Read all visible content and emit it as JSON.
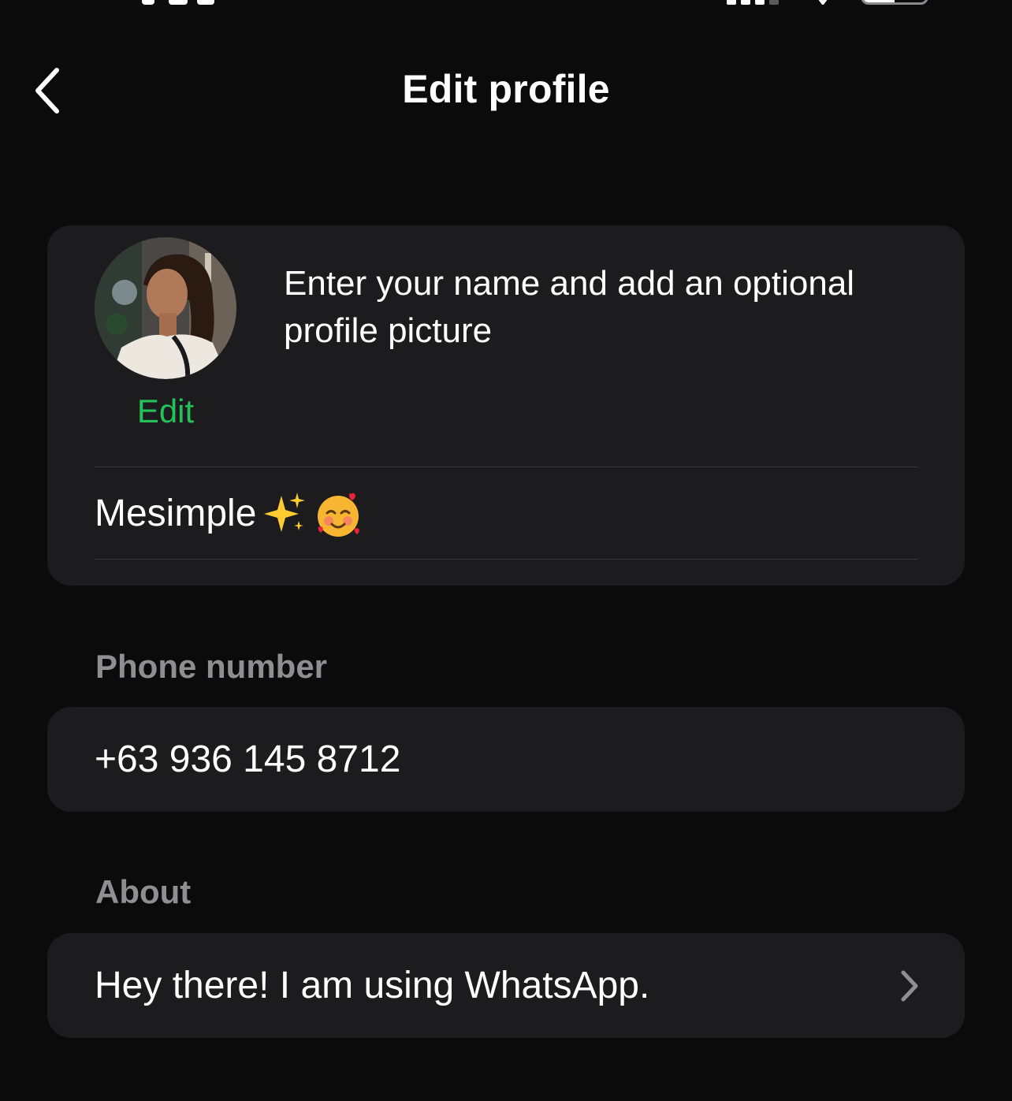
{
  "nav": {
    "title": "Edit profile",
    "back_icon": "chevron-left-icon"
  },
  "profile": {
    "avatar_icon": "profile-photo",
    "edit_label": "Edit",
    "hint": "Enter your name and add an optional profile picture",
    "name": "Mesimple",
    "name_emojis": [
      "sparkles",
      "smiling-face-with-hearts"
    ]
  },
  "phone": {
    "label": "Phone number",
    "value": "+63 936 145 8712"
  },
  "about": {
    "label": "About",
    "value": "Hey there! I am using WhatsApp.",
    "chevron_icon": "chevron-right-icon"
  },
  "colors": {
    "background": "#0b0b0c",
    "card": "#1c1c1e",
    "accent": "#25c15a",
    "secondary_text": "#8e8e93"
  }
}
